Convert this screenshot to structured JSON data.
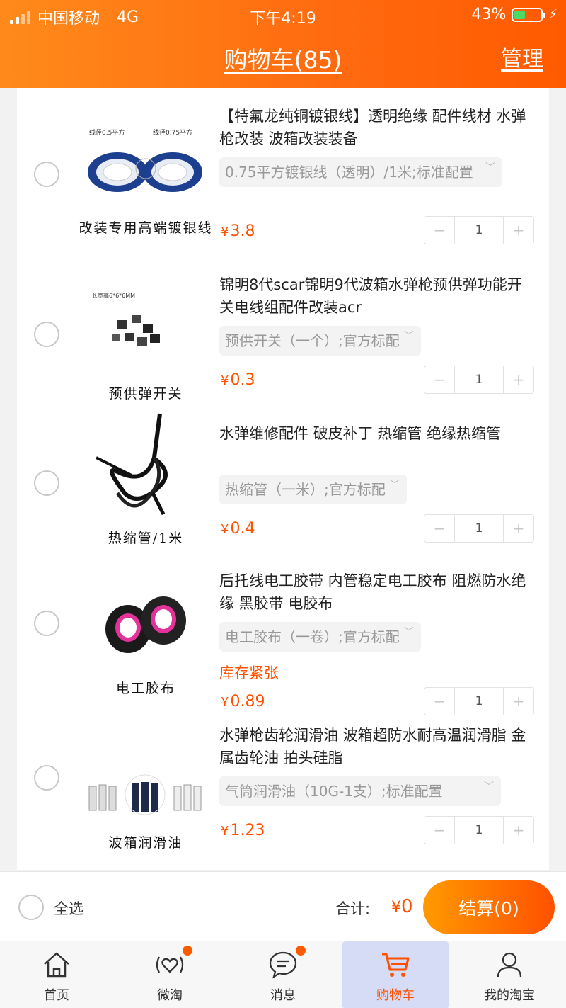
{
  "status_bar": {
    "carrier": "中国移动",
    "network": "4G",
    "time": "下午4:19",
    "battery": "43%",
    "battery_level": 0.43
  },
  "header": {
    "title": "购物车(85)",
    "manage": "管理"
  },
  "items": [
    {
      "thumb_label": "改装专用高端镀银线",
      "title": "【特氟龙纯铜镀银线】透明绝缘 配件线材 水弹枪改装 波箱改装装备",
      "sku": "0.75平方镀银线（透明）/1米;标准配置",
      "stock": "",
      "price_symbol": "¥",
      "price": "3.8",
      "qty": "1",
      "image": "silver-wire-coils"
    },
    {
      "thumb_label": "预供弹开关",
      "title": "锦明8代scar锦明9代波箱水弹枪预供弹功能开关电线组配件改装acr",
      "sku": "预供开关（一个）;官方标配",
      "stock": "",
      "price_symbol": "¥",
      "price": "0.3",
      "qty": "1",
      "image": "micro-switches"
    },
    {
      "thumb_label": "热缩管/1米",
      "title": "水弹维修配件 破皮补丁 热缩管 绝缘热缩管",
      "sku": "热缩管（一米）;官方标配",
      "stock": "",
      "price_symbol": "¥",
      "price": "0.4",
      "qty": "1",
      "image": "heat-shrink-tube"
    },
    {
      "thumb_label": "电工胶布",
      "title": "后托线电工胶带 内管稳定电工胶布 阻燃防水绝缘 黑胶带 电胶布",
      "sku": "电工胶布（一卷）;官方标配",
      "stock": "库存紧张",
      "price_symbol": "¥",
      "price": "0.89",
      "qty": "1",
      "image": "electrical-tape"
    },
    {
      "thumb_label": "波箱润滑油",
      "title": "水弹枪齿轮润滑油 波箱超防水耐高温润滑脂 金属齿轮油 拍头硅脂",
      "sku": "气筒润滑油（10G-1支）;标准配置",
      "stock": "",
      "price_symbol": "¥",
      "price": "1.23",
      "qty": "1",
      "image": "lubricant-tubes"
    }
  ],
  "stepper": {
    "minus": "−",
    "plus": "+"
  },
  "checkout": {
    "select_all": "全选",
    "total_label": "合计:",
    "total_symbol": "¥",
    "total_value": "0",
    "button": "结算(0)"
  },
  "tabs": [
    {
      "label": "首页",
      "icon": "home-icon"
    },
    {
      "label": "微淘",
      "icon": "heart-broadcast-icon"
    },
    {
      "label": "消息",
      "icon": "message-icon"
    },
    {
      "label": "购物车",
      "icon": "cart-icon"
    },
    {
      "label": "我的淘宝",
      "icon": "user-icon"
    }
  ],
  "colors": {
    "accent": "#ff5000",
    "header": "#ff6a10"
  }
}
